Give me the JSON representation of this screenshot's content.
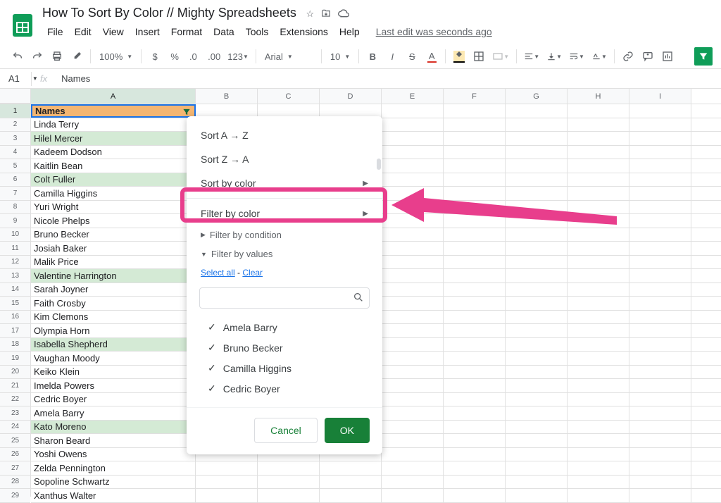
{
  "header": {
    "title": "How To Sort By Color // Mighty Spreadsheets",
    "last_edit": "Last edit was seconds ago"
  },
  "menubar": [
    "File",
    "Edit",
    "View",
    "Insert",
    "Format",
    "Data",
    "Tools",
    "Extensions",
    "Help"
  ],
  "toolbar": {
    "zoom": "100%",
    "font": "Arial",
    "font_size": "10"
  },
  "namebox": {
    "ref": "A1",
    "formula_value": "Names"
  },
  "columns": [
    "A",
    "B",
    "C",
    "D",
    "E",
    "F",
    "G",
    "H",
    "I"
  ],
  "rows": [
    {
      "n": 1,
      "val": "Names",
      "header": true
    },
    {
      "n": 2,
      "val": "Linda Terry"
    },
    {
      "n": 3,
      "val": "Hilel Mercer",
      "hl": true
    },
    {
      "n": 4,
      "val": "Kadeem Dodson"
    },
    {
      "n": 5,
      "val": "Kaitlin Bean"
    },
    {
      "n": 6,
      "val": "Colt Fuller",
      "hl": true
    },
    {
      "n": 7,
      "val": "Camilla Higgins"
    },
    {
      "n": 8,
      "val": "Yuri Wright"
    },
    {
      "n": 9,
      "val": "Nicole Phelps"
    },
    {
      "n": 10,
      "val": "Bruno Becker"
    },
    {
      "n": 11,
      "val": "Josiah Baker"
    },
    {
      "n": 12,
      "val": "Malik Price"
    },
    {
      "n": 13,
      "val": "Valentine Harrington",
      "hl": true
    },
    {
      "n": 14,
      "val": "Sarah Joyner"
    },
    {
      "n": 15,
      "val": "Faith Crosby"
    },
    {
      "n": 16,
      "val": "Kim Clemons"
    },
    {
      "n": 17,
      "val": "Olympia Horn"
    },
    {
      "n": 18,
      "val": "Isabella Shepherd",
      "hl": true
    },
    {
      "n": 19,
      "val": "Vaughan Moody"
    },
    {
      "n": 20,
      "val": "Keiko Klein"
    },
    {
      "n": 21,
      "val": "Imelda Powers"
    },
    {
      "n": 22,
      "val": "Cedric Boyer"
    },
    {
      "n": 23,
      "val": "Amela Barry"
    },
    {
      "n": 24,
      "val": "Kato Moreno",
      "hl": true
    },
    {
      "n": 25,
      "val": "Sharon Beard"
    },
    {
      "n": 26,
      "val": "Yoshi Owens"
    },
    {
      "n": 27,
      "val": "Zelda Pennington"
    },
    {
      "n": 28,
      "val": "Sopoline Schwartz"
    },
    {
      "n": 29,
      "val": "Xanthus Walter"
    }
  ],
  "filter_menu": {
    "sort_az": "Sort A → Z",
    "sort_za": "Sort Z → A",
    "sort_color": "Sort by color",
    "filter_color": "Filter by color",
    "filter_condition": "Filter by condition",
    "filter_values": "Filter by values",
    "select_all": "Select all",
    "link_sep": " - ",
    "clear": "Clear",
    "search_placeholder": "",
    "values": [
      "Amela Barry",
      "Bruno Becker",
      "Camilla Higgins",
      "Cedric Boyer"
    ],
    "cancel": "Cancel",
    "ok": "OK"
  }
}
